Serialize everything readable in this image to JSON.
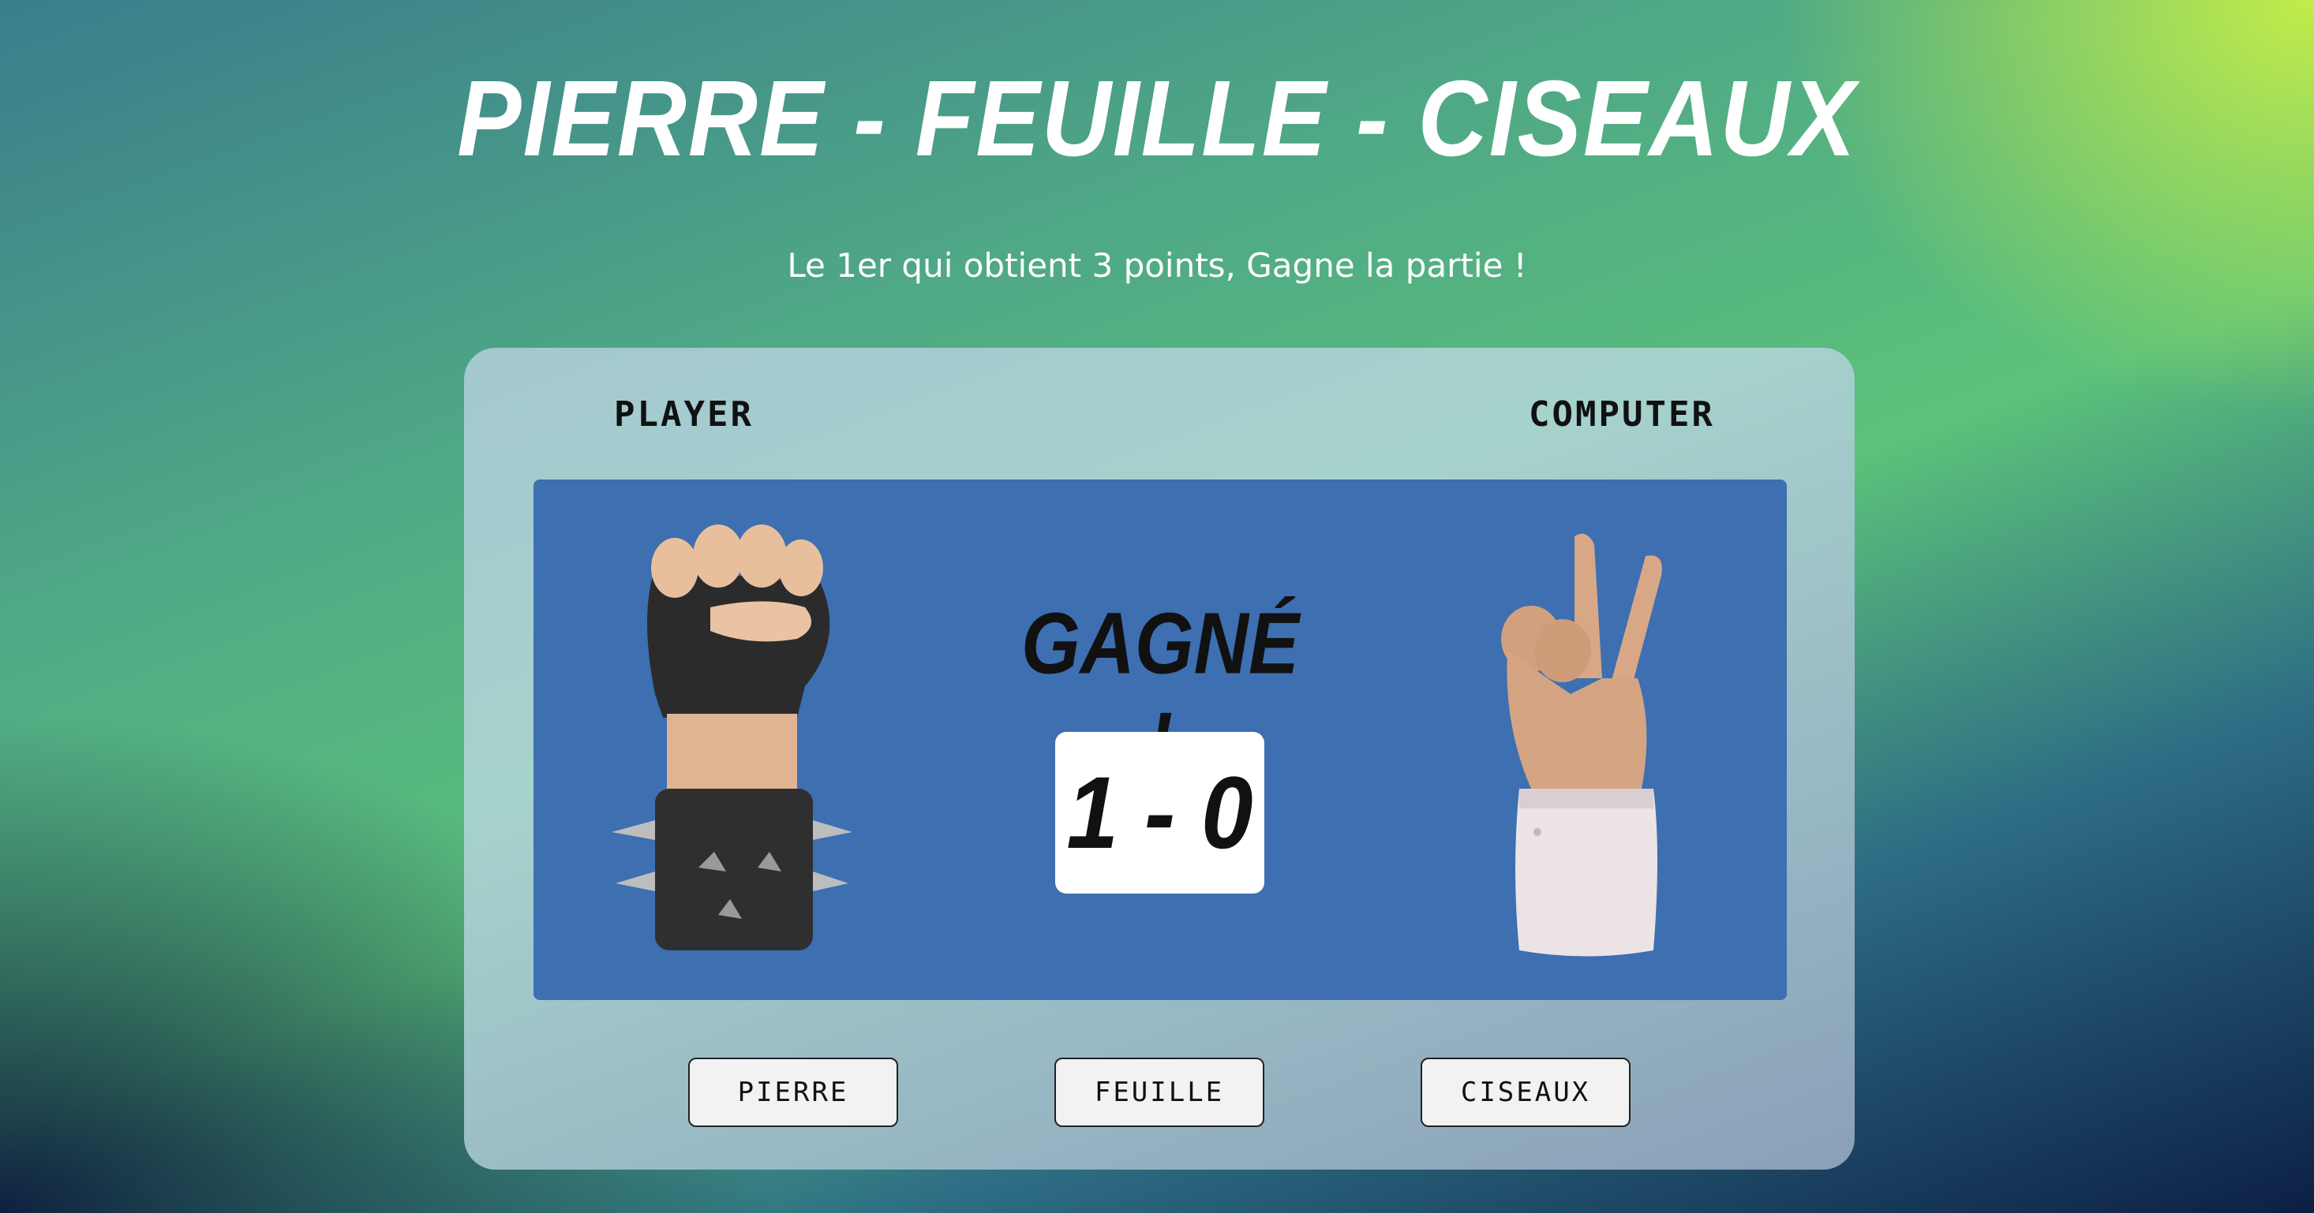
{
  "header": {
    "title": "PIERRE - FEUILLE - CISEAUX",
    "subtitle": "Le 1er qui obtient 3 points, Gagne la partie !"
  },
  "game": {
    "player_label": "PLAYER",
    "computer_label": "COMPUTER",
    "result_text": "GAGNÉ !",
    "score": "1 - 0",
    "player_choice_icon": "rock-fist-icon",
    "computer_choice_icon": "scissors-hand-icon"
  },
  "controls": {
    "pierre_label": "PIERRE",
    "feuille_label": "FEUILLE",
    "ciseaux_label": "CISEAUX"
  },
  "colors": {
    "arena": "#3d6fb1",
    "panel": "#a3c8cf",
    "accent_lime": "#c8f046",
    "dark_navy": "#0c1f45"
  }
}
